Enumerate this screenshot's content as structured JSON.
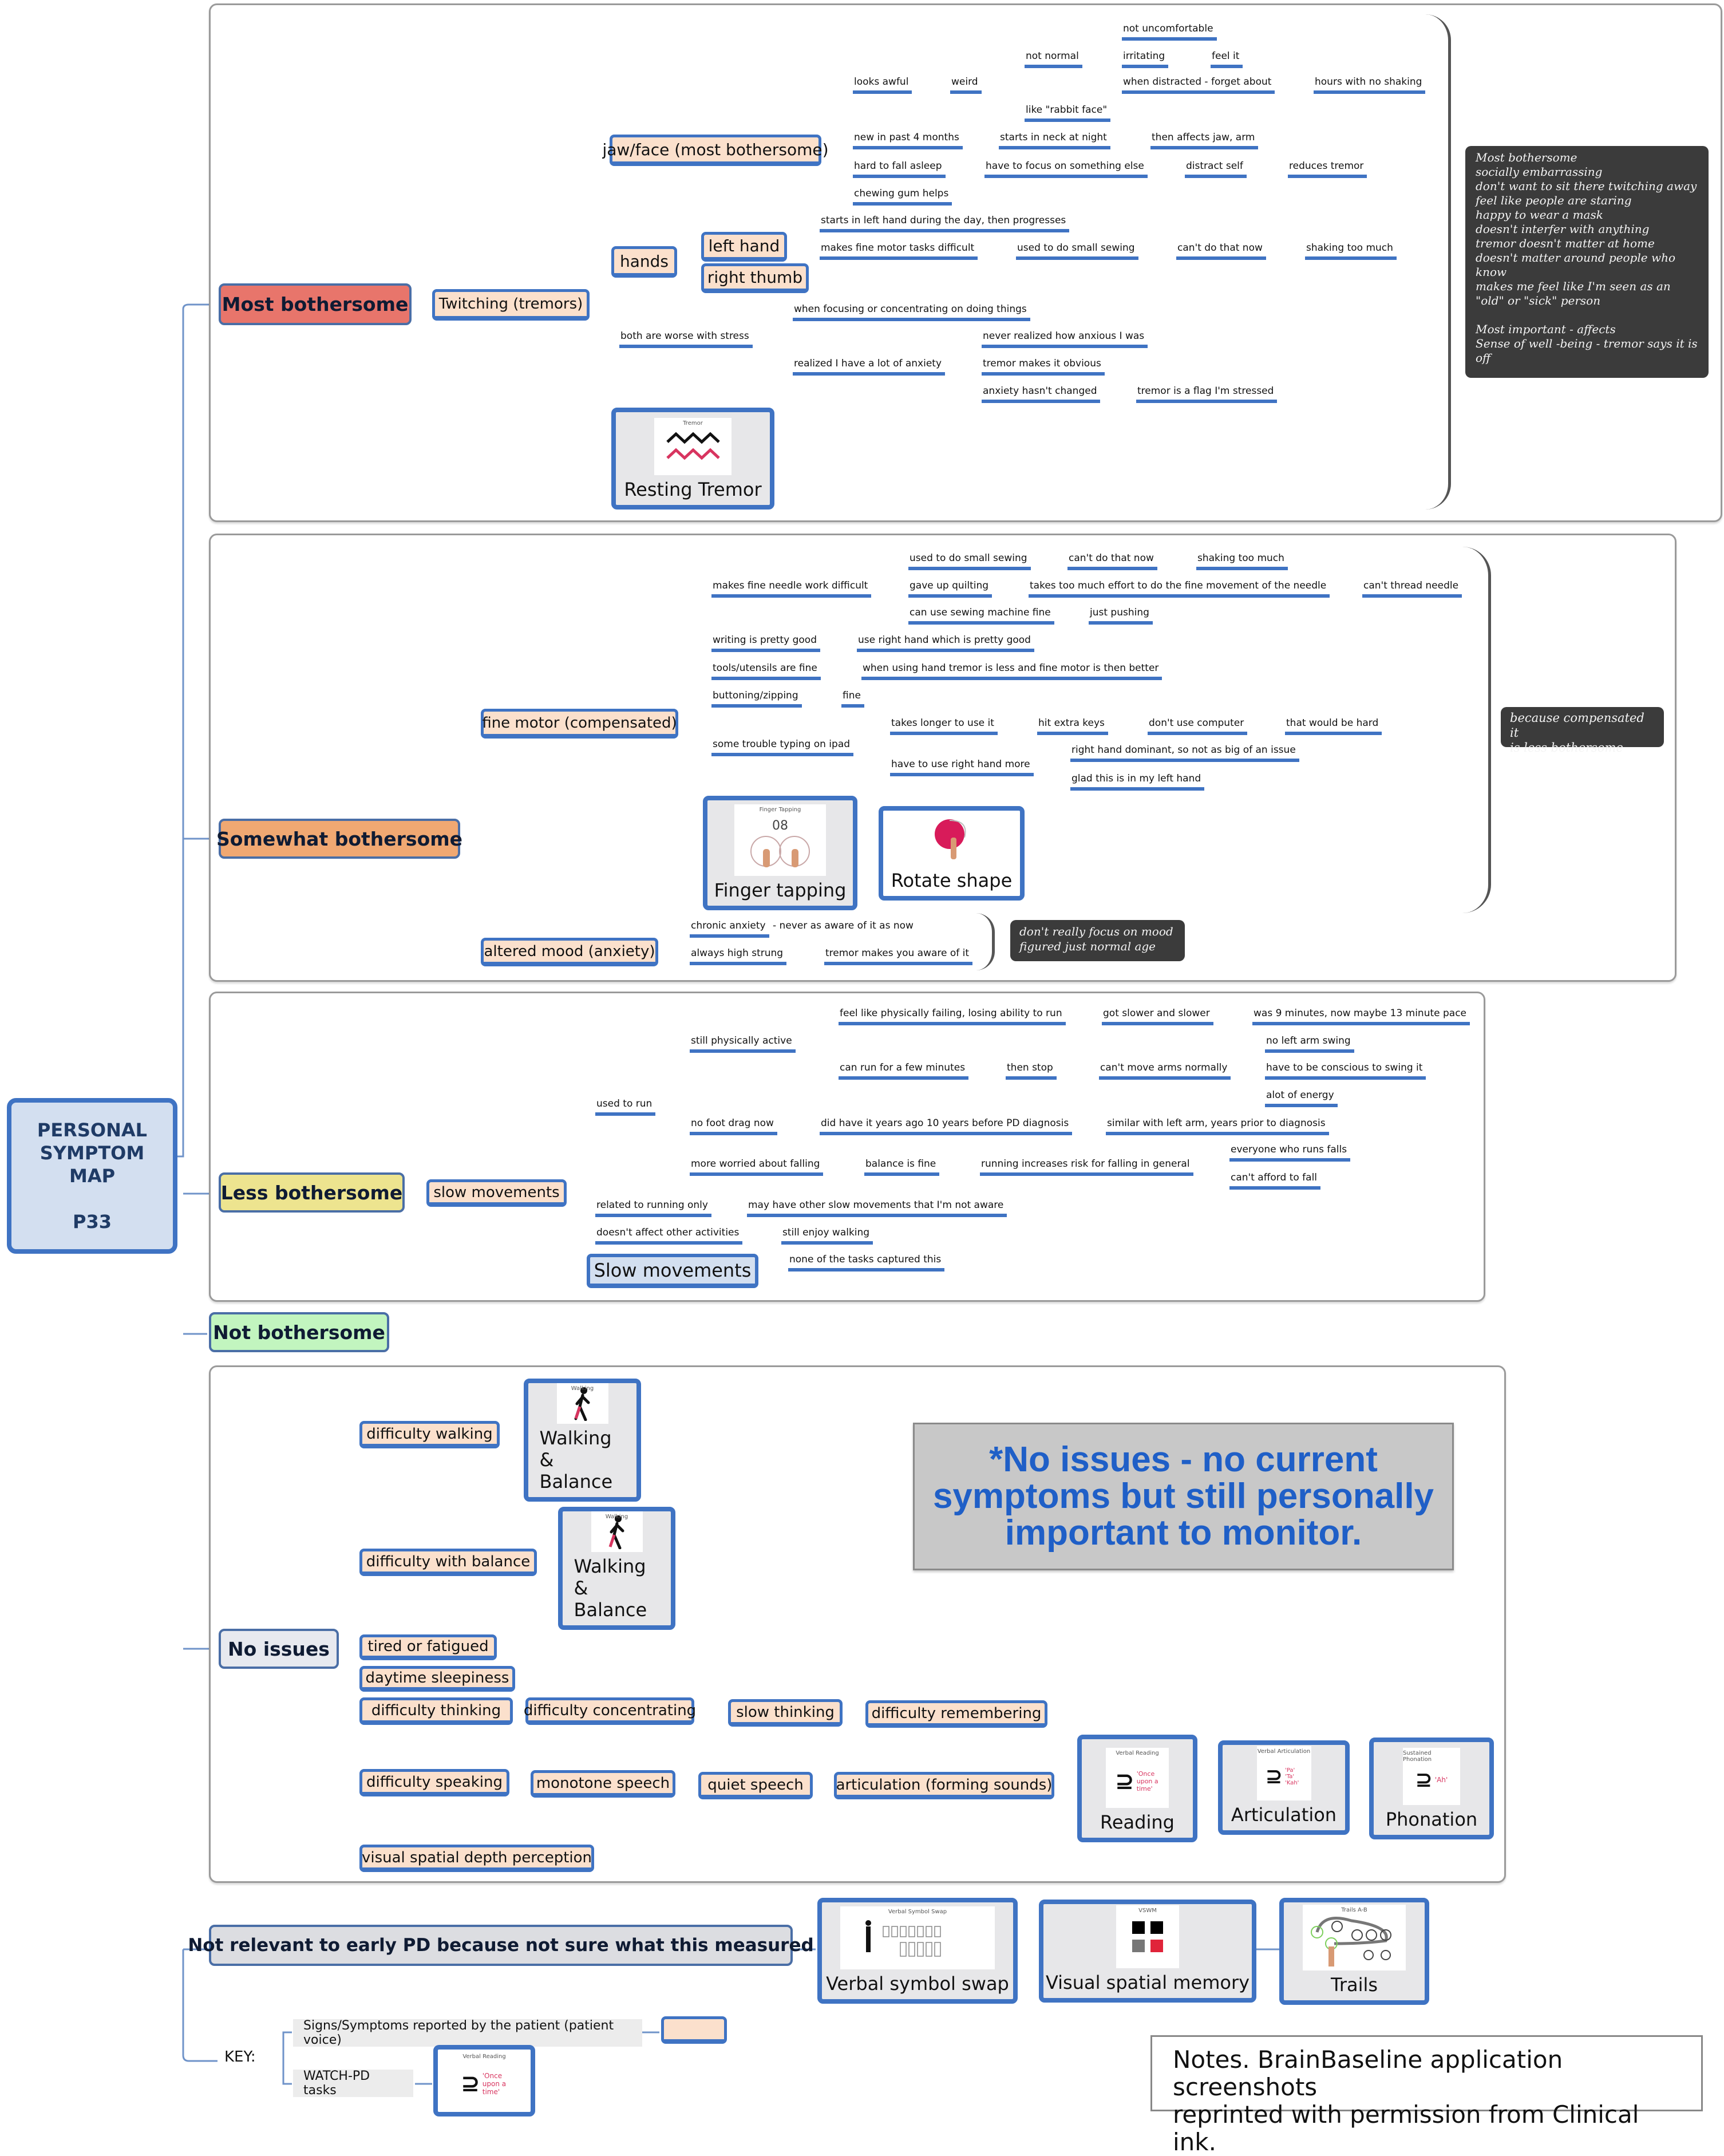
{
  "root": {
    "line1": "PERSONAL",
    "line2": "SYMPTOM",
    "line3": "MAP",
    "participant": "P33"
  },
  "colors": {
    "most": "#e8756b",
    "somewhat": "#f0a872",
    "less": "#ede48f",
    "not": "#c2f5bf",
    "noissues": "#e7e9ef",
    "notrelevant": "#dcdde1",
    "symptom_fill": "#fbe0cc",
    "task_border": "#3f73c3",
    "callout_text": "#1f5fc7"
  },
  "most": {
    "label": "Most bothersome",
    "symptom": "Twitching (tremors)",
    "jaw": {
      "label": "jaw/face (most bothersome)",
      "looks_awful": "looks awful",
      "weird": "weird",
      "not_normal": "not normal",
      "not_uncomfortable": "not uncomfortable",
      "irritating": "irritating",
      "feel_it": "feel it",
      "when_distracted": "when distracted - forget about",
      "hours_no_shaking": "hours with no shaking",
      "rabbit_face": "like \"rabbit face\"",
      "new_past": "new in past 4 months",
      "starts_neck": "starts in neck at night",
      "then_affects": "then affects jaw, arm",
      "hard_asleep": "hard to fall asleep",
      "focus_else": "have to focus on something else",
      "distract_self": "distract self",
      "reduces_tremor": "reduces tremor",
      "chewing_gum": "chewing gum helps"
    },
    "hands": {
      "label": "hands",
      "left": "left hand",
      "right": "right thumb",
      "starts_left": "starts in left hand during the day, then progresses",
      "fine_motor": "makes fine motor tasks difficult",
      "small_sewing": "used to do small sewing",
      "cant_now": "can't do that now",
      "shaking": "shaking too much"
    },
    "stress": {
      "label": "both are worse with stress",
      "focusing": "when focusing or concentrating on doing things",
      "anxiety": "realized I have a lot of anxiety",
      "never_realized": "never realized how anxious I was",
      "obvious": "tremor makes it obvious",
      "unchanged": "anxiety hasn't changed",
      "flag": "tremor is a flag I'm stressed"
    },
    "task": {
      "caption": "Tremor",
      "label": "Resting Tremor"
    },
    "note": "Most bothersome\nsocially embarrassing\ndon't want to sit there twitching away\nfeel like people are staring\nhappy to wear a mask\ndoesn't interfer with anything\ntremor doesn't matter at home\ndoesn't matter around people who know\nmakes me feel like I'm seen as an \"old\" or \"sick\" person\n\nMost important - affects\nSense of well -being - tremor says it is off"
  },
  "somewhat": {
    "label": "Somewhat bothersome",
    "fine": {
      "label": "fine motor (compensated)",
      "needle": "makes fine needle work difficult",
      "small_sewing": "used to do small sewing",
      "cant_now": "can't do that now",
      "shaking": "shaking too much",
      "quilting": "gave up quilting",
      "effort": "takes too much effort to do the fine movement of the needle",
      "thread": "can't thread needle",
      "machine": "can use sewing machine fine",
      "pushing": "just pushing",
      "writing": "writing is pretty good",
      "right_hand": "use right hand which is pretty good",
      "tools": "tools/utensils are fine",
      "tools_detail": "when using hand tremor is less and fine motor is then better",
      "buttoning": "buttoning/zipping",
      "fine": "fine",
      "ipad": "some trouble typing on ipad",
      "longer": "takes longer to use it",
      "extra_keys": "hit extra keys",
      "no_computer": "don't use computer",
      "hard": "that would be hard",
      "use_right": "have to use right hand more",
      "dominant": "right hand dominant, so not as big of an issue",
      "glad": "glad this is in my left hand"
    },
    "tasks": [
      {
        "caption": "Finger Tapping",
        "count": "08",
        "label": "Finger tapping"
      },
      {
        "label": "Rotate shape"
      }
    ],
    "note": "because compensated it\nis less bothersome",
    "mood": {
      "label": "altered mood (anxiety)",
      "chronic": "chronic anxiety",
      "never_aware": "- never as aware of it as now",
      "high_strung": "always high strung",
      "makes_aware": "tremor makes you aware of it",
      "note": "don't really focus on mood\nfigured just normal age"
    }
  },
  "less": {
    "label": "Less bothersome",
    "symptom": "slow movements",
    "used_to_run": "used to run",
    "active": "still physically active",
    "failing": "feel like physically failing, losing ability to run",
    "slower": "got slower and slower",
    "pace": "was 9 minutes, now maybe 13 minute pace",
    "run_few": "can run for a few minutes",
    "then_stop": "then stop",
    "arms": "can't move arms normally",
    "no_swing": "no left arm swing",
    "conscious": "have to be conscious to swing it",
    "energy": "alot of energy",
    "foot_drag": "no foot drag now",
    "years_ago": "did have it years ago 10 years before PD diagnosis",
    "left_arm": "similar with left arm, years prior to diagnosis",
    "falling": "more worried about falling",
    "balance_fine": "balance is fine",
    "risk": "running increases risk for falling in general",
    "everyone": "everyone who runs falls",
    "afford": "can't afford to fall",
    "running_only": "related to running only",
    "other_slow": "may have other slow movements that I'm not aware",
    "not_affect": "doesn't affect other activities",
    "walking": "still enjoy walking",
    "task": "Slow movements",
    "none_captured": "none of the tasks captured this"
  },
  "not": {
    "label": "Not bothersome"
  },
  "noissues": {
    "label": "No issues",
    "walking": "difficulty walking",
    "balance": "difficulty with balance",
    "tired": "tired or fatigued",
    "sleepy": "daytime sleepiness",
    "thinking": "difficulty thinking",
    "concentrating": "difficulty concentrating",
    "slow_thinking": "slow thinking",
    "remembering": "difficulty remembering",
    "speaking": "difficulty speaking",
    "monotone": "monotone speech",
    "quiet": "quiet speech",
    "articulation": "articulation (forming sounds)",
    "visual": "visual spatial depth perception",
    "tasks": [
      {
        "caption": "Walking",
        "label": "Walking & Balance"
      },
      {
        "caption": "Walking",
        "label": "Walking & Balance"
      },
      {
        "caption": "Verbal Reading",
        "quote": "'Once upon a time'",
        "label": "Reading"
      },
      {
        "caption": "Verbal Articulation",
        "quote": "'Pa' 'Ta' 'Kah'",
        "label": "Articulation"
      },
      {
        "caption": "Sustained Phonation",
        "quote": "'Ah'",
        "label": "Phonation"
      }
    ],
    "callout": "*No issues - no current symptoms but still personally important to monitor."
  },
  "notrelevant": {
    "label": "Not relevant to early PD because not sure what this measured",
    "tasks": [
      {
        "caption": "Verbal Symbol Swap",
        "label": "Verbal symbol swap"
      },
      {
        "caption": "VSWM",
        "label": "Visual spatial memory"
      },
      {
        "caption": "Trails A-B",
        "label": "Trails"
      }
    ]
  },
  "key": {
    "label": "KEY:",
    "symptoms": "Signs/Symptoms reported by the patient (patient voice)",
    "tasks": "WATCH-PD tasks",
    "task_caption": "Verbal Reading",
    "task_quote": "'Once upon a time'"
  },
  "notes": "Notes.  BrainBaseline application screenshots\nreprinted with permission from Clinical ink."
}
